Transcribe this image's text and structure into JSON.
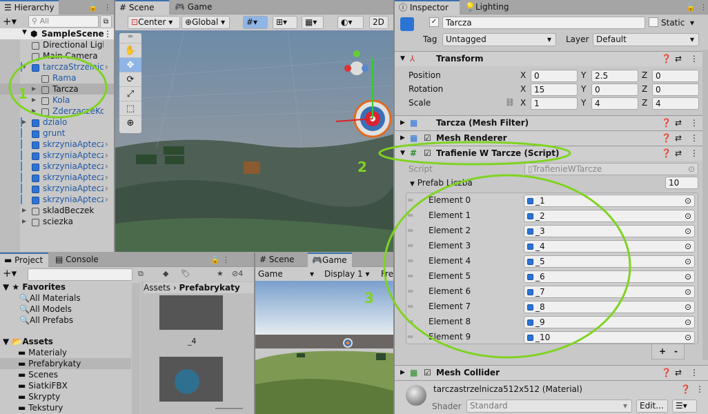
{
  "hierarchy": {
    "tab": "Hierarchy",
    "search_placeholder": "All",
    "scene": "SampleScene",
    "items": [
      {
        "label": "Directional Light",
        "indent": 2,
        "blue": false,
        "arrow": "",
        "chev": false
      },
      {
        "label": "Main Camera",
        "indent": 2,
        "blue": false,
        "arrow": "",
        "chev": false
      },
      {
        "label": "tarczaStrzelnicza",
        "indent": 2,
        "blue": true,
        "arrow": "▼",
        "chev": true
      },
      {
        "label": "Rama",
        "indent": 3,
        "blue": true,
        "arrow": "",
        "chev": false
      },
      {
        "label": "Tarcza",
        "indent": 3,
        "blue": false,
        "arrow": "▶",
        "chev": false,
        "selected": true
      },
      {
        "label": "Kola",
        "indent": 3,
        "blue": true,
        "arrow": "▶",
        "chev": false
      },
      {
        "label": "ZderzaczeKola",
        "indent": 3,
        "blue": true,
        "arrow": "▶",
        "chev": false
      },
      {
        "label": "dzialo",
        "indent": 2,
        "blue": true,
        "arrow": "▶",
        "chev": false
      },
      {
        "label": "grunt",
        "indent": 2,
        "blue": true,
        "arrow": "",
        "chev": false
      },
      {
        "label": "skrzyniaApteczna",
        "indent": 2,
        "blue": true,
        "arrow": "",
        "chev": true
      },
      {
        "label": "skrzyniaApteczna",
        "indent": 2,
        "blue": true,
        "arrow": "",
        "chev": true
      },
      {
        "label": "skrzyniaApteczna",
        "indent": 2,
        "blue": true,
        "arrow": "",
        "chev": true
      },
      {
        "label": "skrzyniaApteczna",
        "indent": 2,
        "blue": true,
        "arrow": "",
        "chev": true
      },
      {
        "label": "skrzyniaApteczna",
        "indent": 2,
        "blue": true,
        "arrow": "",
        "chev": true
      },
      {
        "label": "skrzyniaApteczna",
        "indent": 2,
        "blue": true,
        "arrow": "",
        "chev": true
      },
      {
        "label": "skladBeczek",
        "indent": 2,
        "blue": false,
        "arrow": "▶",
        "chev": false
      },
      {
        "label": "sciezka",
        "indent": 2,
        "blue": false,
        "arrow": "▶",
        "chev": false
      }
    ]
  },
  "scene": {
    "tabs": [
      "Scene",
      "Game"
    ],
    "pivot": "Center",
    "space": "Global",
    "mode2d": "2D",
    "tools": [
      "hand",
      "move",
      "rotate",
      "scale",
      "rect",
      "transform"
    ]
  },
  "project": {
    "tabs": [
      "Project",
      "Console"
    ],
    "hidden_count": "4",
    "favorites": "Favorites",
    "fav_items": [
      "All Materials",
      "All Models",
      "All Prefabs"
    ],
    "assets": "Assets",
    "folders": [
      "Materialy",
      "Prefabrykaty",
      "Scenes",
      "SiatkiFBX",
      "Skrypty",
      "Tekstury"
    ],
    "selected_folder": "Prefabrykaty",
    "breadcrumb": [
      "Assets",
      "Prefabrykaty"
    ],
    "asset_label": "_4"
  },
  "game": {
    "tabs": [
      "Scene",
      "Game"
    ],
    "mode": "Game",
    "display": "Display 1",
    "aspect": "Free"
  },
  "inspector": {
    "tabs": [
      "Inspector",
      "Lighting"
    ],
    "name": "Tarcza",
    "static": "Static",
    "tag_label": "Tag",
    "tag": "Untagged",
    "layer_label": "Layer",
    "layer": "Default",
    "transform": {
      "title": "Transform",
      "rows": [
        {
          "label": "Position",
          "x": "0",
          "y": "2.5",
          "z": "0"
        },
        {
          "label": "Rotation",
          "x": "15",
          "y": "0",
          "z": "0"
        },
        {
          "label": "Scale",
          "x": "1",
          "y": "4",
          "z": "4"
        }
      ]
    },
    "mesh_filter": "Tarcza (Mesh Filter)",
    "mesh_renderer": "Mesh Renderer",
    "script_comp": "Trafienie W Tarcze (Script)",
    "script_label": "Script",
    "script_value": "TrafienieWTarcze",
    "prefab_label": "Prefab Liczba",
    "prefab_count": "10",
    "elements": [
      {
        "label": "Element 0",
        "value": "_1"
      },
      {
        "label": "Element 1",
        "value": "_2"
      },
      {
        "label": "Element 2",
        "value": "_3"
      },
      {
        "label": "Element 3",
        "value": "_4"
      },
      {
        "label": "Element 4",
        "value": "_5"
      },
      {
        "label": "Element 5",
        "value": "_6"
      },
      {
        "label": "Element 6",
        "value": "_7"
      },
      {
        "label": "Element 7",
        "value": "_8"
      },
      {
        "label": "Element 8",
        "value": "_9"
      },
      {
        "label": "Element 9",
        "value": "_10"
      }
    ],
    "plus": "+",
    "minus": "-",
    "mesh_collider": "Mesh Collider",
    "material": "tarczastrzelnicza512x512 (Material)",
    "shader_label": "Shader",
    "shader": "Standard",
    "edit": "Edit..."
  },
  "annotations": [
    "1",
    "2",
    "3"
  ],
  "colors": {
    "annotation": "#7fd321",
    "accent": "#3a72b0",
    "prefab_blue": "#1f57a3"
  }
}
